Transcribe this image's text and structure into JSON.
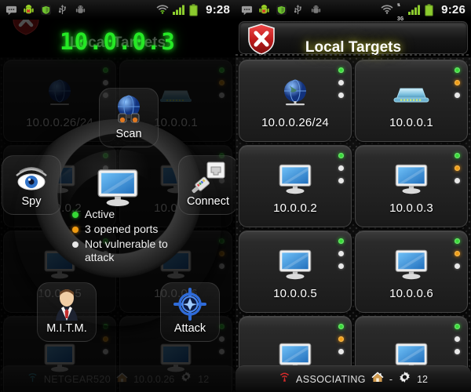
{
  "left_panel": {
    "statusbar": {
      "icons": [
        "sms-icon",
        "android-bug-icon",
        "shield-green-icon",
        "usb-icon",
        "android-debug-icon"
      ],
      "right_icons": [
        "wifi-icon",
        "signal-bars-icon",
        "battery-icon"
      ],
      "clock": "9:28"
    },
    "titlebar": {
      "title": "Local Targets",
      "shield_icon": "red-shield-x-icon"
    },
    "lcd_display": "10.0.0.3",
    "radial_menu": {
      "items": [
        {
          "label": "Scan",
          "icon": "globe-binoculars-icon"
        },
        {
          "label": "Spy",
          "icon": "eye-icon"
        },
        {
          "label": "Connect",
          "icon": "rj45-plug-icon"
        },
        {
          "label": "M.I.T.M.",
          "icon": "businessman-icon"
        },
        {
          "label": "Attack",
          "icon": "crosshair-target-icon"
        }
      ],
      "center_icon": "monitor-icon",
      "legend": [
        {
          "color": "#35d935",
          "text": "Active"
        },
        {
          "color": "#ef9b12",
          "text": "3 opened ports"
        },
        {
          "color": "#e8e8e8",
          "text": "Not vulnerable to attack"
        }
      ]
    },
    "bottombar": {
      "wifi_icon": "wifi-signal-icon",
      "network": "NETGEAR520",
      "home_icon": "house-icon",
      "gateway": "10.0.0.26",
      "gear_icon": "gear-icon",
      "count": "12"
    }
  },
  "right_panel": {
    "statusbar": {
      "icons": [
        "sms-icon",
        "android-bug-icon",
        "shield-green-icon",
        "usb-icon",
        "android-debug-icon"
      ],
      "right_icons": [
        "wifi-icon",
        "3g-icon",
        "signal-bars-icon",
        "battery-icon"
      ],
      "network_type": "3G",
      "clock": "9:26"
    },
    "titlebar": {
      "title": "Local Targets",
      "shield_icon": "red-shield-x-icon"
    },
    "targets": [
      {
        "label": "10.0.0.26/24",
        "icon": "globe-icon",
        "leds": [
          "green",
          "white",
          "white"
        ]
      },
      {
        "label": "10.0.0.1",
        "icon": "router-icon",
        "leds": [
          "green",
          "orange",
          "white"
        ]
      },
      {
        "label": "10.0.0.2",
        "icon": "monitor-icon",
        "leds": [
          "green",
          "white",
          "white"
        ]
      },
      {
        "label": "10.0.0.3",
        "icon": "monitor-icon",
        "leds": [
          "green",
          "orange",
          "white"
        ]
      },
      {
        "label": "10.0.0.5",
        "icon": "monitor-icon",
        "leds": [
          "green",
          "white",
          "white"
        ]
      },
      {
        "label": "10.0.0.6",
        "icon": "monitor-icon",
        "leds": [
          "green",
          "orange",
          "white"
        ]
      },
      {
        "label": "",
        "icon": "monitor-icon",
        "leds": [
          "green",
          "orange",
          "white"
        ]
      },
      {
        "label": "",
        "icon": "monitor-icon",
        "leds": [
          "green",
          "white",
          "white"
        ]
      }
    ],
    "bottombar": {
      "wifi_icon": "wifi-red-icon",
      "network": "ASSOCIATING",
      "home_icon": "house-icon",
      "gateway": "-",
      "gear_icon": "gear-icon",
      "count": "12"
    }
  },
  "colors": {
    "led_green": "#35d935",
    "led_orange": "#ef9b12",
    "led_white": "#e8e8e8",
    "lcd_green": "#25e825",
    "shield_red": "#cc2222",
    "title_glow": "#d6d63c"
  }
}
